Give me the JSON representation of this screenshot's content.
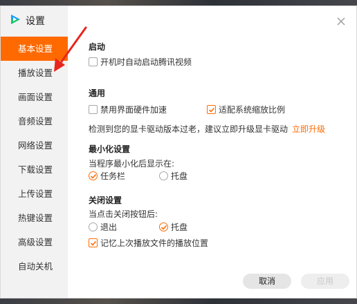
{
  "window": {
    "title": "设置",
    "logo_icon": "tencent-video-logo-icon",
    "accent": "#ff6a00"
  },
  "sidebar": {
    "items": [
      {
        "label": "基本设置",
        "active": true
      },
      {
        "label": "播放设置",
        "active": false
      },
      {
        "label": "画面设置",
        "active": false
      },
      {
        "label": "音频设置",
        "active": false
      },
      {
        "label": "网络设置",
        "active": false
      },
      {
        "label": "下载设置",
        "active": false
      },
      {
        "label": "上传设置",
        "active": false
      },
      {
        "label": "热键设置",
        "active": false
      },
      {
        "label": "高级设置",
        "active": false
      },
      {
        "label": "自动关机",
        "active": false
      }
    ]
  },
  "startup": {
    "title": "启动",
    "autostart": {
      "label": "开机时自动启动腾讯视频",
      "checked": false
    }
  },
  "general": {
    "title": "通用",
    "hw_accel": {
      "label": "禁用界面硬件加速",
      "checked": false
    },
    "scaling": {
      "label": "适配系统缩放比例",
      "checked": true
    },
    "driver_notice": "检测到您的显卡驱动版本过老，建议立即升级显卡驱动",
    "upgrade_link": "立即升级"
  },
  "minimize": {
    "title": "最小化设置",
    "prompt": "当程序最小化后显示在:",
    "options": [
      {
        "label": "任务栏",
        "selected": true
      },
      {
        "label": "托盘",
        "selected": false
      }
    ]
  },
  "close": {
    "title": "关闭设置",
    "prompt": "当点击关闭按钮后:",
    "options": [
      {
        "label": "退出",
        "selected": false
      },
      {
        "label": "托盘",
        "selected": true
      }
    ],
    "remember": {
      "label": "记忆上次播放文件的播放位置",
      "checked": true
    }
  },
  "footer": {
    "cancel_label": "取消",
    "apply_label": "应用",
    "apply_enabled": false
  }
}
